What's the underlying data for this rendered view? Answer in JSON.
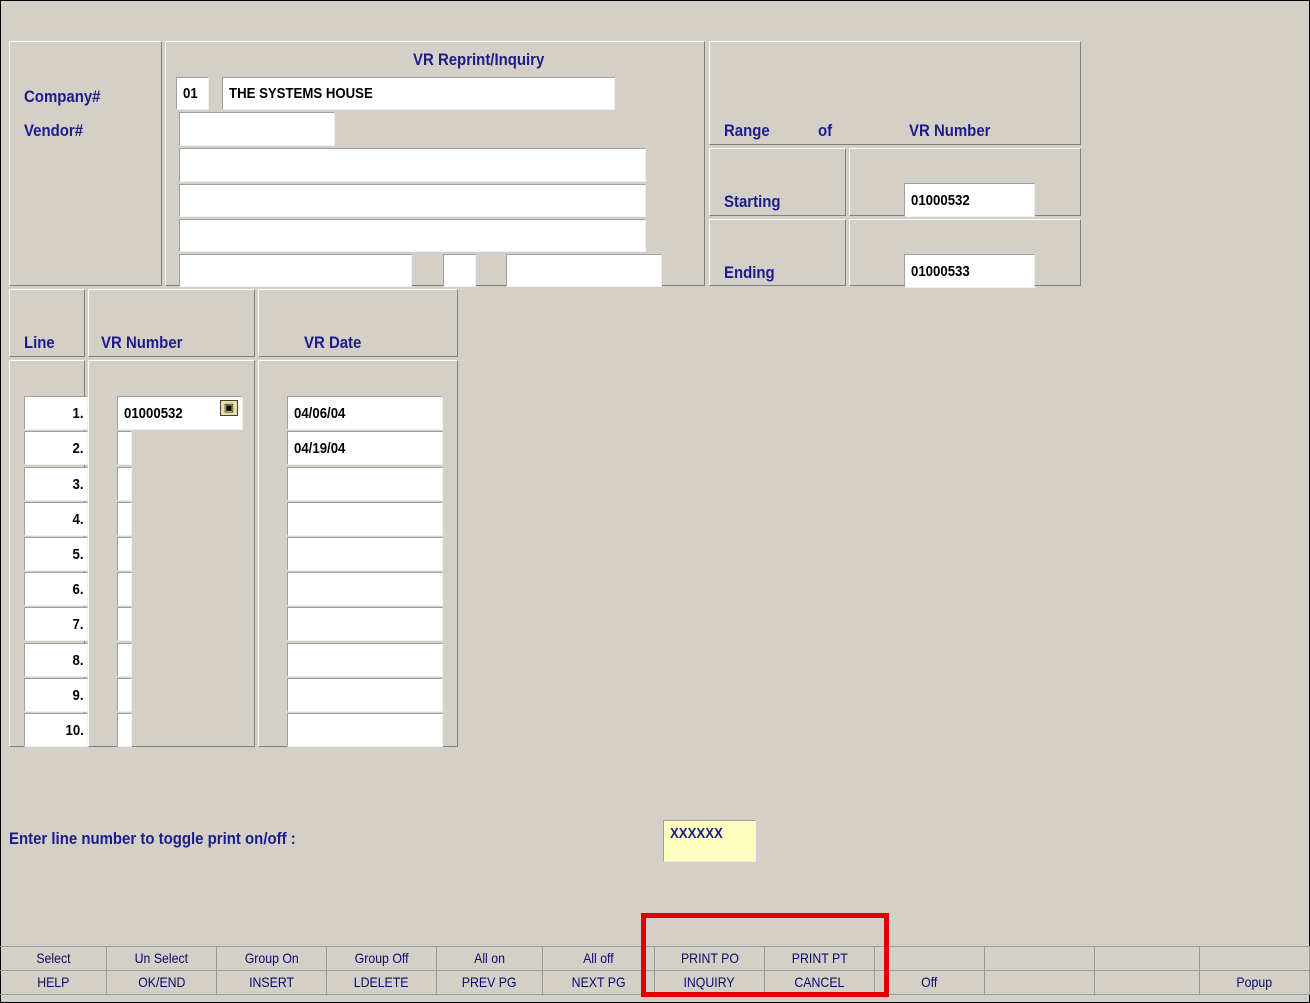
{
  "header": {
    "title": "VR Reprint/Inquiry"
  },
  "company": {
    "label": "Company#",
    "number": "01",
    "name": "THE SYSTEMS HOUSE"
  },
  "vendor": {
    "label": "Vendor#",
    "value": ""
  },
  "range": {
    "range_label": "Range",
    "of_label": "of",
    "column_label": "VR Number",
    "starting_label": "Starting",
    "starting_value": "01000532",
    "ending_label": "Ending",
    "ending_value": "01000533"
  },
  "grid": {
    "headers": {
      "line": "Line",
      "vr_number": "VR Number",
      "vr_date": "VR Date"
    },
    "rows": [
      {
        "line": "1.",
        "vr": "01000532",
        "date": "04/06/04"
      },
      {
        "line": "2.",
        "vr": "",
        "date": "04/19/04"
      },
      {
        "line": "3.",
        "vr": "",
        "date": ""
      },
      {
        "line": "4.",
        "vr": "",
        "date": ""
      },
      {
        "line": "5.",
        "vr": "",
        "date": ""
      },
      {
        "line": "6.",
        "vr": "",
        "date": ""
      },
      {
        "line": "7.",
        "vr": "",
        "date": ""
      },
      {
        "line": "8.",
        "vr": "",
        "date": ""
      },
      {
        "line": "9.",
        "vr": "",
        "date": ""
      },
      {
        "line": "10.",
        "vr": "",
        "date": ""
      }
    ]
  },
  "prompt": {
    "label": "Enter line number to toggle print on/off :",
    "value": "XXXXXX"
  },
  "fkeys": {
    "top": [
      "Select",
      "Un Select",
      "Group On",
      "Group Off",
      "All on",
      "All off",
      "PRINT PO",
      "PRINT PT",
      "",
      "",
      "",
      ""
    ],
    "bottom": [
      "HELP",
      "OK/END",
      "INSERT",
      "LDELETE",
      "PREV PG",
      "NEXT PG",
      "INQUIRY",
      "CANCEL",
      "Off",
      "",
      "",
      "Popup"
    ]
  },
  "colors": {
    "background": "#d4d0c8",
    "label": "#1c1c8c",
    "prompt_field": "#ffffc0",
    "highlight": "#e00000"
  },
  "icons": {
    "lookup": "camera-icon"
  }
}
